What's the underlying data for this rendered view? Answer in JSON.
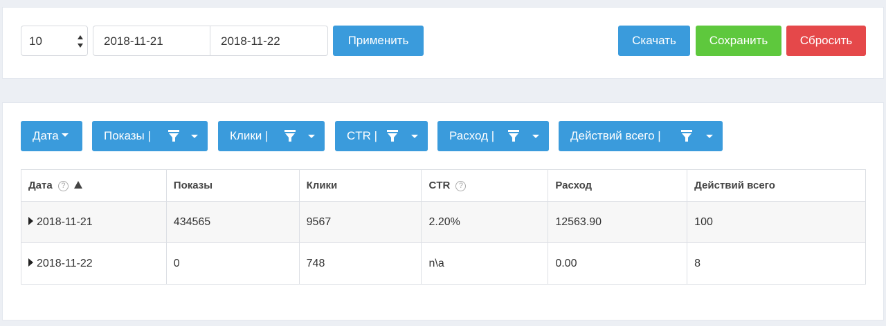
{
  "toolbar": {
    "rows_select": {
      "value": "10"
    },
    "date_from": "2018-11-21",
    "date_to": "2018-11-22",
    "apply_label": "Применить",
    "download_label": "Скачать",
    "save_label": "Сохранить",
    "reset_label": "Сбросить"
  },
  "columns_bar": {
    "date_label": "Дата",
    "impressions_label": "Показы |",
    "clicks_label": "Клики |",
    "ctr_label": "CTR |",
    "spend_label": "Расход |",
    "actions_label": "Действий всего |"
  },
  "table": {
    "headers": [
      "Дата",
      "Показы",
      "Клики",
      "CTR",
      "Расход",
      "Действий всего"
    ],
    "rows": [
      [
        "2018-11-21",
        "434565",
        "9567",
        "2.20%",
        "12563.90",
        "100"
      ],
      [
        "2018-11-22",
        "0",
        "748",
        "n\\a",
        "0.00",
        "8"
      ]
    ]
  },
  "icons": {
    "help": "?",
    "funnel": "funnel-icon",
    "sort": "sort-asc-icon",
    "expand": "triangle-right-icon"
  },
  "colors": {
    "primary": "#3a9bdc",
    "success": "#5ec83d",
    "danger": "#e5484a"
  }
}
